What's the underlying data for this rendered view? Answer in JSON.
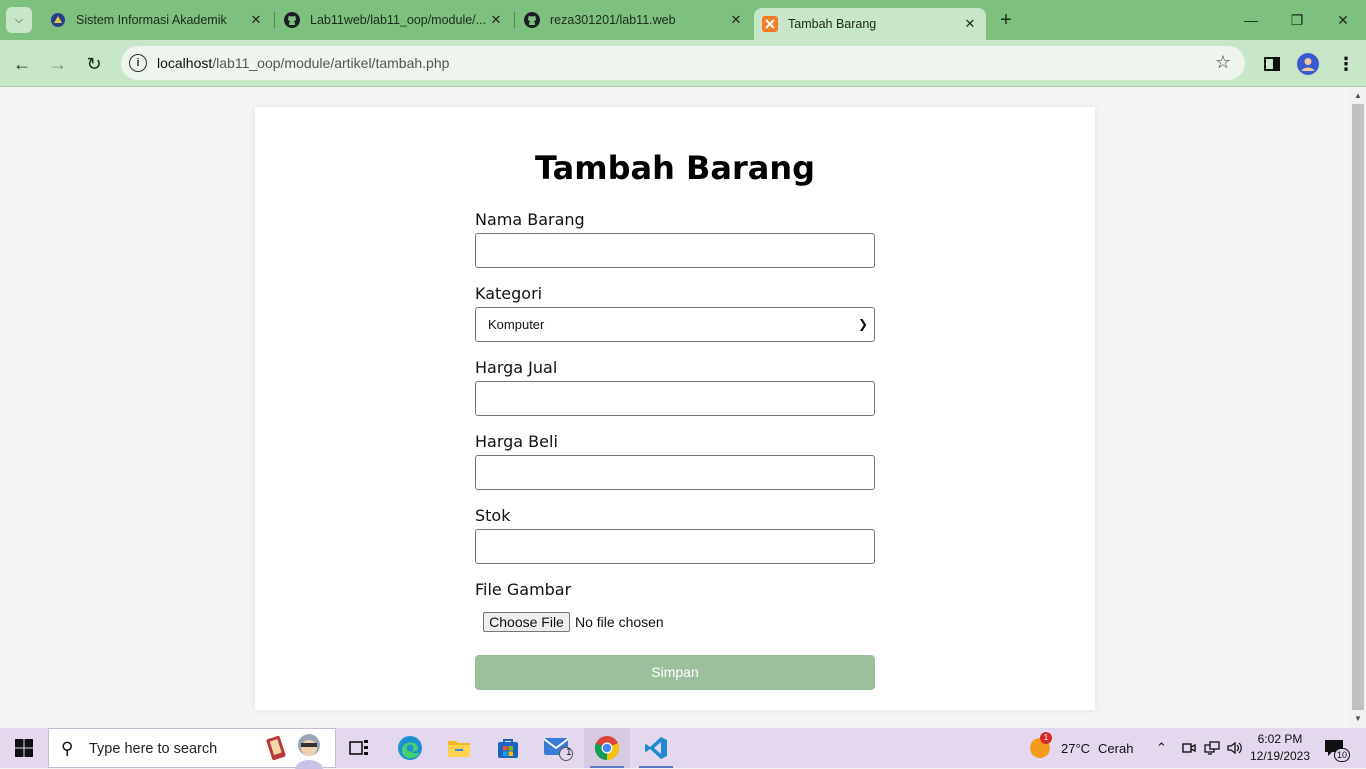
{
  "browser": {
    "tabs": [
      {
        "title": "Sistem Informasi Akademik",
        "active": false,
        "icon": "university-icon"
      },
      {
        "title": "Lab11web/lab11_oop/module/...",
        "active": false,
        "icon": "github-icon"
      },
      {
        "title": "reza301201/lab11.web",
        "active": false,
        "icon": "github-icon"
      },
      {
        "title": "Tambah Barang",
        "active": true,
        "icon": "xampp-icon"
      }
    ],
    "url_host": "localhost",
    "url_path": "/lab11_oop/module/artikel/tambah.php"
  },
  "form": {
    "title": "Tambah Barang",
    "fields": {
      "nama_label": "Nama Barang",
      "nama_value": "",
      "kategori_label": "Kategori",
      "kategori_selected": "Komputer",
      "harga_jual_label": "Harga Jual",
      "harga_jual_value": "",
      "harga_beli_label": "Harga Beli",
      "harga_beli_value": "",
      "stok_label": "Stok",
      "stok_value": "",
      "gambar_label": "File Gambar",
      "file_button": "Choose File",
      "file_status": "No file chosen"
    },
    "submit_label": "Simpan"
  },
  "taskbar": {
    "search_placeholder": "Type here to search",
    "weather_temp": "27°C",
    "weather_desc": "Cerah",
    "weather_badge": "1",
    "mail_badge": "1",
    "time": "6:02 PM",
    "date": "12/19/2023",
    "notification_count": "10"
  },
  "colors": {
    "tabstrip": "#7ec07e",
    "toolbar": "#c8e6c8",
    "submit_button": "#9cbf9c",
    "taskbar": "#e4d8ee"
  }
}
